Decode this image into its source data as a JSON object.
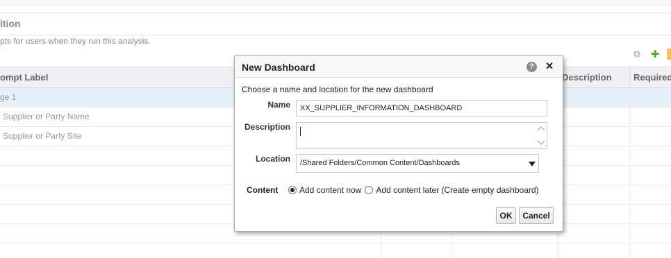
{
  "background": {
    "section_title": "ition",
    "section_description": "pts for users when they run this analysis.",
    "toolbar_icons": [
      "copy-icon",
      "add-icon"
    ],
    "columns": [
      "ompt Label",
      "Description",
      "Required"
    ],
    "rows": [
      {
        "label": "ge 1",
        "selected": true
      },
      {
        "label": "Supplier or Party Name",
        "selected": false
      },
      {
        "label": "Supplier or Party Site",
        "selected": false
      },
      {
        "label": "",
        "selected": false
      },
      {
        "label": "",
        "selected": false
      },
      {
        "label": "",
        "selected": false
      },
      {
        "label": "",
        "selected": false
      },
      {
        "label": "",
        "selected": false
      }
    ]
  },
  "dialog": {
    "title": "New Dashboard",
    "help_icon": "?",
    "close_icon": "×",
    "instruction": "Choose a name and location for the new dashboard",
    "name_label": "Name",
    "name_value": "XX_SUPPLIER_INFORMATION_DASHBOARD",
    "description_label": "Description",
    "description_value": "",
    "location_label": "Location",
    "location_value": "/Shared Folders/Common Content/Dashboards",
    "content_label": "Content",
    "content_options": [
      {
        "label": "Add content now",
        "checked": true
      },
      {
        "label": "Add content later (Create empty dashboard)",
        "checked": false
      }
    ],
    "ok_label": "OK",
    "cancel_label": "Cancel"
  },
  "colors": {
    "selected_row": "#e6f0fa",
    "header_bg": "#eef0f3",
    "add_icon": "#5aa832"
  }
}
